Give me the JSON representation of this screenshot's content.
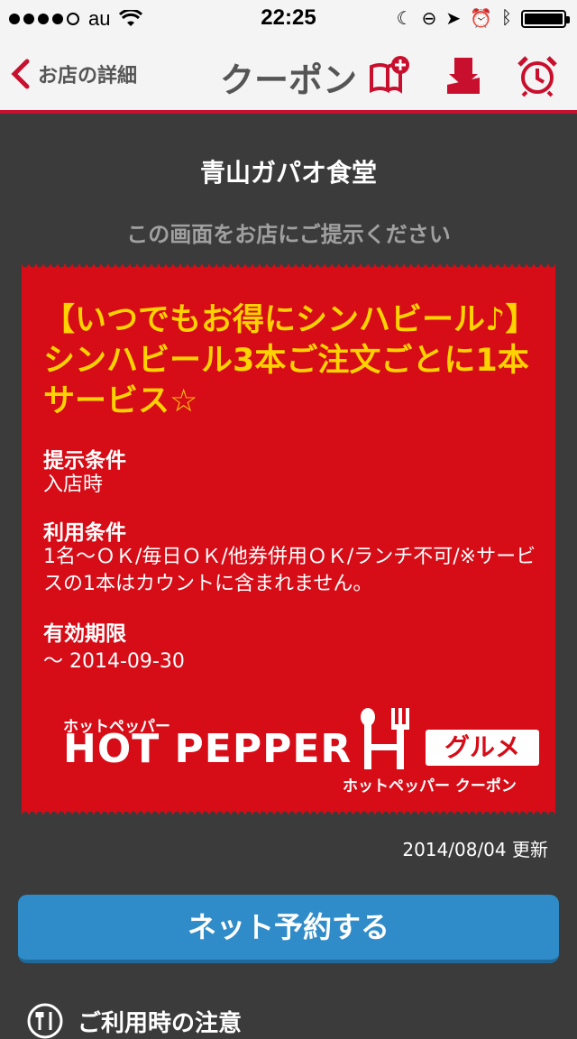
{
  "status": {
    "carrier": "au",
    "time": "22:25"
  },
  "nav": {
    "back_label": "お店の詳細",
    "title": "クーポン"
  },
  "shop": {
    "name": "青山ガパオ食堂",
    "instruction": "この画面をお店にご提示ください"
  },
  "coupon": {
    "title": "【いつでもお得にシンハビール♪】シンハビール3本ご注文ごとに1本サービス☆",
    "condition_label": "提示条件",
    "condition_value": "入店時",
    "usage_label": "利用条件",
    "usage_value": "1名～ＯＫ/毎日ＯＫ/他券併用ＯＫ/ランチ不可/※サービスの1本はカウントに含まれません。",
    "expiry_label": "有効期限",
    "expiry_value": "～ 2014-09-30",
    "logo": {
      "small": "ホットペッパー",
      "main": "HOT PEPPER",
      "gurume": "グルメ",
      "sub": "ホットペッパー クーポン"
    }
  },
  "updated": "2014/08/04 更新",
  "reserve_button": "ネット予約する",
  "notice_label": "ご利用時の注意",
  "colors": {
    "accent": "#c8102e",
    "coupon_bg": "#d60c17",
    "coupon_title": "#ffd200",
    "button": "#2f8cc8"
  }
}
